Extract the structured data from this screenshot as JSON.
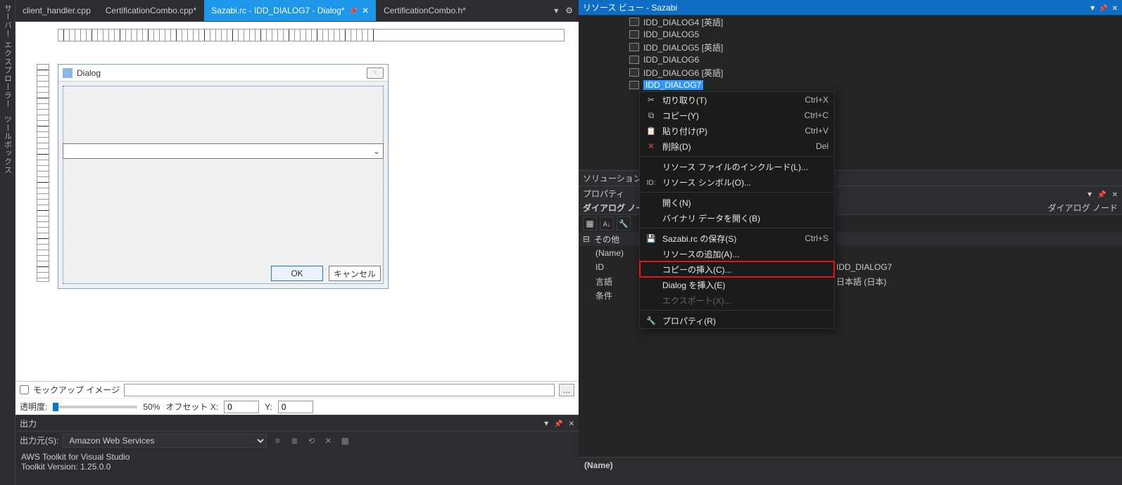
{
  "sidebar_left": {
    "server_explorer": "サーバー エクスプローラー",
    "toolbox": "ツールボックス"
  },
  "tabs": [
    {
      "label": "client_handler.cpp",
      "dirty": false
    },
    {
      "label": "CertificationCombo.cpp*",
      "dirty": true
    },
    {
      "label": "Sazabi.rc - IDD_DIALOG7 - Dialog*",
      "dirty": true,
      "active": true
    },
    {
      "label": "CertificationCombo.h*",
      "dirty": true
    }
  ],
  "dialog_editor": {
    "title": "Dialog",
    "ok": "OK",
    "cancel": "キャンセル"
  },
  "mockup_row": {
    "checkbox_label": "モックアップ イメージ",
    "browse": "..."
  },
  "transparency_row": {
    "label": "透明度:",
    "percent": "50%",
    "offset_x_label": "オフセット X:",
    "offset_x": "0",
    "offset_y_label": "Y:",
    "offset_y": "0"
  },
  "output": {
    "title": "出力",
    "source_label": "出力元(S):",
    "source_value": "Amazon Web Services",
    "lines": [
      "AWS Toolkit for Visual Studio",
      "Toolkit Version: 1.25.0.0"
    ]
  },
  "resource_view": {
    "header": "リソース ビュー - Sazabi",
    "items": [
      "IDD_DIALOG4 [英語]",
      "IDD_DIALOG5",
      "IDD_DIALOG5 [英語]",
      "IDD_DIALOG6",
      "IDD_DIALOG6 [英語]",
      "IDD_DIALOG7"
    ],
    "selected_index": 5
  },
  "solution_explorer": {
    "title": "ソリューション エクス"
  },
  "properties": {
    "title": "プロパティ",
    "subtitle": "ダイアログ ノード",
    "visible_type": "ダイアログ ノード",
    "category": "その他",
    "rows": [
      {
        "k": "(Name)",
        "v": ""
      },
      {
        "k": "ID",
        "v": "IDD_DIALOG7"
      },
      {
        "k": "言語",
        "v": "日本語 (日本)"
      },
      {
        "k": "条件",
        "v": ""
      }
    ],
    "desc_title": "(Name)"
  },
  "context_menu": {
    "cut": {
      "label": "切り取り(T)",
      "sc": "Ctrl+X"
    },
    "copy": {
      "label": "コピー(Y)",
      "sc": "Ctrl+C"
    },
    "paste": {
      "label": "貼り付け(P)",
      "sc": "Ctrl+V"
    },
    "delete": {
      "label": "削除(D)",
      "sc": "Del"
    },
    "res_include": "リソース ファイルのインクルード(L)...",
    "res_symbol": "リソース シンボル(O)...",
    "open": "開く(N)",
    "open_binary": "バイナリ データを開く(B)",
    "save": {
      "label": "Sazabi.rc の保存(S)",
      "sc": "Ctrl+S"
    },
    "add_resource": "リソースの追加(A)...",
    "insert_copy": "コピーの挿入(C)...",
    "insert_dialog": "Dialog を挿入(E)",
    "export": "エクスポート(X)...",
    "properties": "プロパティ(R)"
  }
}
